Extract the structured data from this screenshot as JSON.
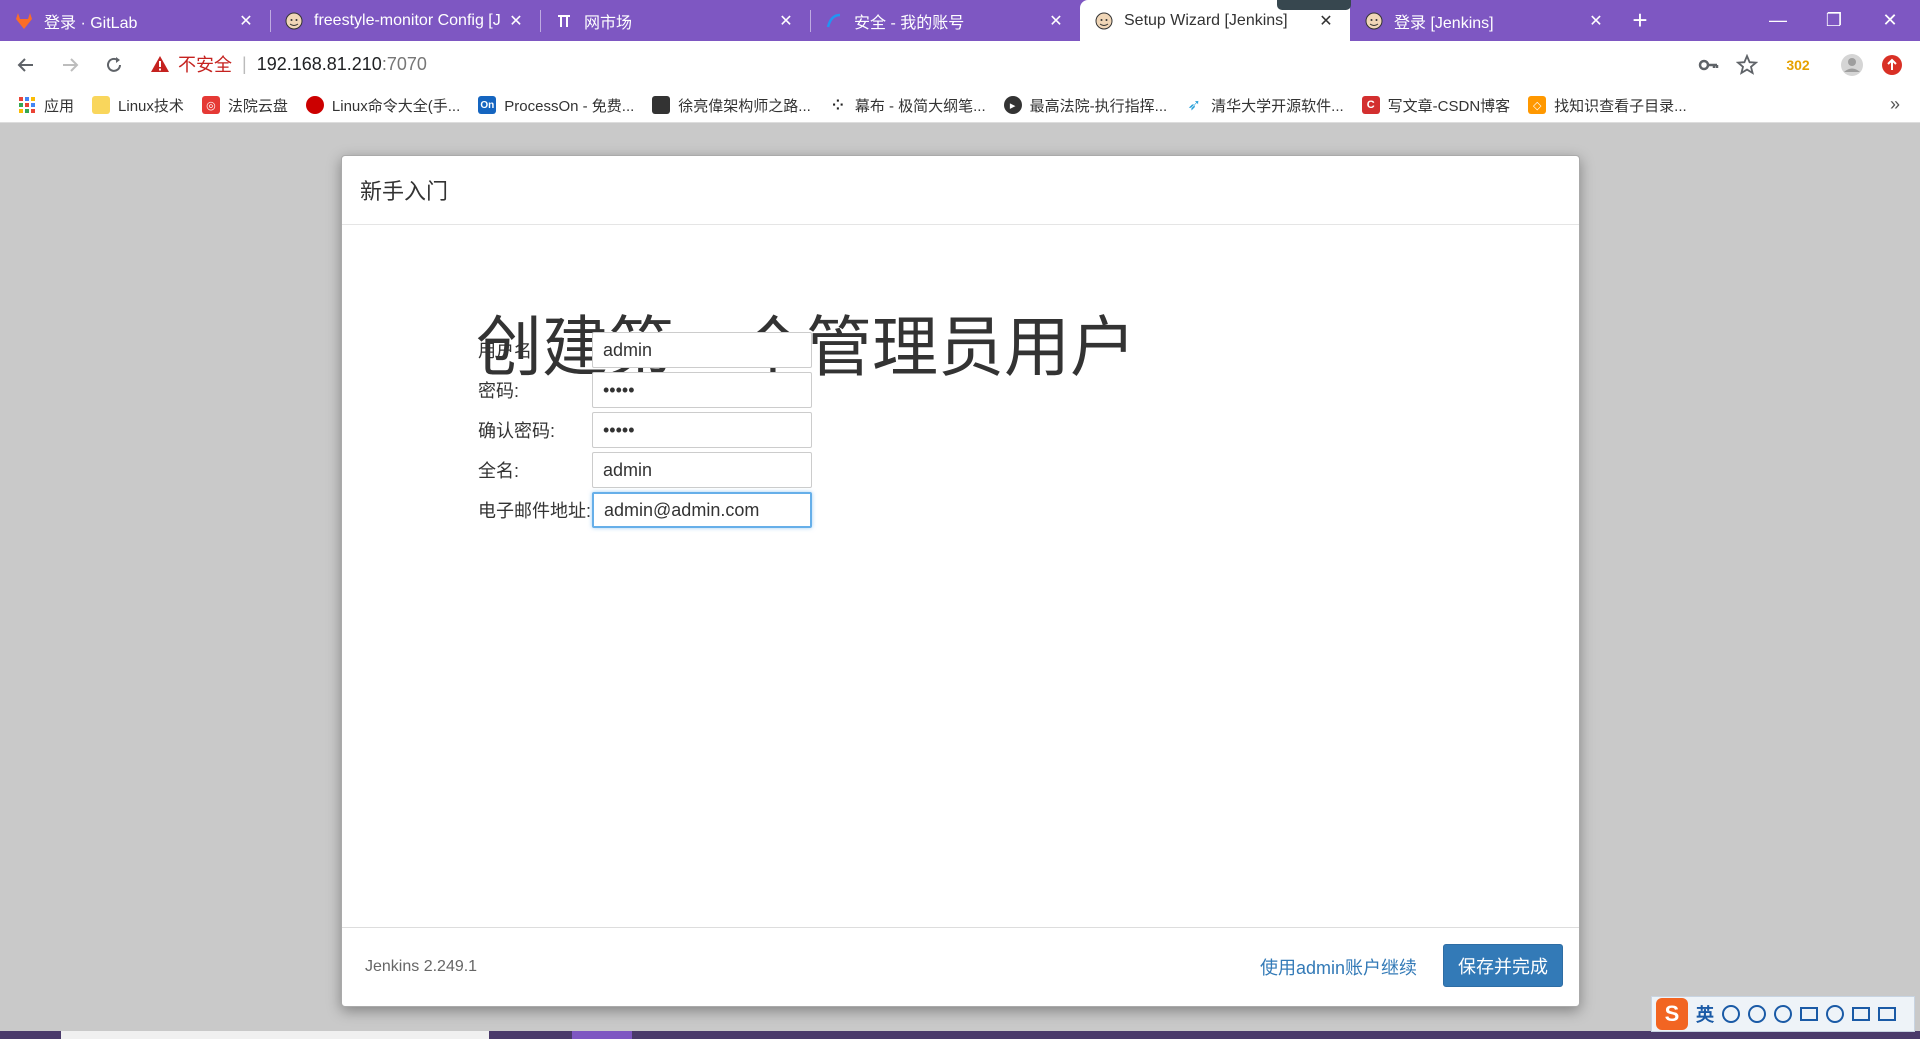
{
  "browser": {
    "tabs": [
      {
        "title": "登录 · GitLab",
        "icon": "gitlab-icon",
        "active": false
      },
      {
        "title": "freestyle-monitor Config [J",
        "icon": "jenkins-icon",
        "active": false
      },
      {
        "title": "网市场",
        "icon": "pi-icon",
        "active": false
      },
      {
        "title": "安全 - 我的账号",
        "icon": "tencent-icon",
        "active": false
      },
      {
        "title": "Setup Wizard [Jenkins]",
        "icon": "jenkins-icon",
        "active": true
      },
      {
        "title": "登录 [Jenkins]",
        "icon": "jenkins-icon",
        "active": false
      }
    ],
    "new_tab": "+",
    "window_controls": {
      "minimize": "—",
      "restore": "❐",
      "close": "✕"
    },
    "address": {
      "security_label": "不安全",
      "separator": "|",
      "host": "192.168.81.210",
      "port": ":7070"
    },
    "toolbar_badge": "302",
    "bookmarks": [
      {
        "label": "应用",
        "icon": "apps-grid-icon",
        "color": "#4285f4"
      },
      {
        "label": "Linux技术",
        "icon": "folder-icon",
        "color": "#f9d65c"
      },
      {
        "label": "法院云盘",
        "icon": "cloud-drive-icon",
        "color": "#e53935"
      },
      {
        "label": "Linux命令大全(手...",
        "icon": "redhat-icon",
        "color": "#cc0000"
      },
      {
        "label": "ProcessOn - 免费...",
        "icon": "processon-icon",
        "color": "#1565c0"
      },
      {
        "label": "徐亮偉架构师之路...",
        "icon": "blog-icon",
        "color": "#333333"
      },
      {
        "label": "幕布 - 极简大纲笔...",
        "icon": "mubu-icon",
        "color": "#222222"
      },
      {
        "label": "最高法院-执行指挥...",
        "icon": "court-icon",
        "color": "#333333"
      },
      {
        "label": "清华大学开源软件...",
        "icon": "tuna-icon",
        "color": "#2aa1d9"
      },
      {
        "label": "写文章-CSDN博客",
        "icon": "csdn-icon",
        "color": "#d32f2f"
      },
      {
        "label": "找知识查看子目录...",
        "icon": "knowledge-icon",
        "color": "#ff9800"
      }
    ],
    "bookmarks_more": "»"
  },
  "wizard": {
    "header": "新手入门",
    "title": "创建第一个管理员用户",
    "fields": [
      {
        "label": "用户名:",
        "value": "admin",
        "type": "text"
      },
      {
        "label": "密码:",
        "value": "•••••",
        "type": "password"
      },
      {
        "label": "确认密码:",
        "value": "•••••",
        "type": "password"
      },
      {
        "label": "全名:",
        "value": "admin",
        "type": "text"
      },
      {
        "label": "电子邮件地址:",
        "value": "admin@admin.com",
        "type": "text"
      }
    ],
    "version": "Jenkins 2.249.1",
    "continue_link": "使用admin账户继续",
    "save_button": "保存并完成"
  },
  "ime": {
    "logo": "S",
    "mode": "英"
  }
}
